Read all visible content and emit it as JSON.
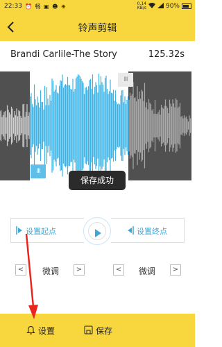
{
  "status_bar": {
    "time": "22:33",
    "notification_icons": "⏰ 畅 ▣ ☻ ⊕",
    "speed": "0.14\nKB/s",
    "battery": "90%"
  },
  "header": {
    "title": "铃声剪辑"
  },
  "song": {
    "name": "Brandi Carlile-The Story",
    "duration": "125.32s"
  },
  "waveform": {
    "selected_color": "#3bb3e6",
    "unselected_color": "#a8a8a8",
    "handle_left_label": "III",
    "handle_right_label": "III"
  },
  "toast": {
    "text": "保存成功"
  },
  "controls": {
    "set_start_label": "设置起点",
    "set_end_label": "设置终点",
    "fine_tune_left": {
      "prev": "<",
      "label": "微调",
      "next": ">"
    },
    "fine_tune_right": {
      "prev": "<",
      "label": "微调",
      "next": ">"
    }
  },
  "bottom_bar": {
    "settings_label": "设置",
    "save_label": "保存"
  },
  "colors": {
    "accent_yellow": "#f7d63e",
    "accent_blue": "#3fa6d8",
    "arrow_red": "#e8261e"
  }
}
